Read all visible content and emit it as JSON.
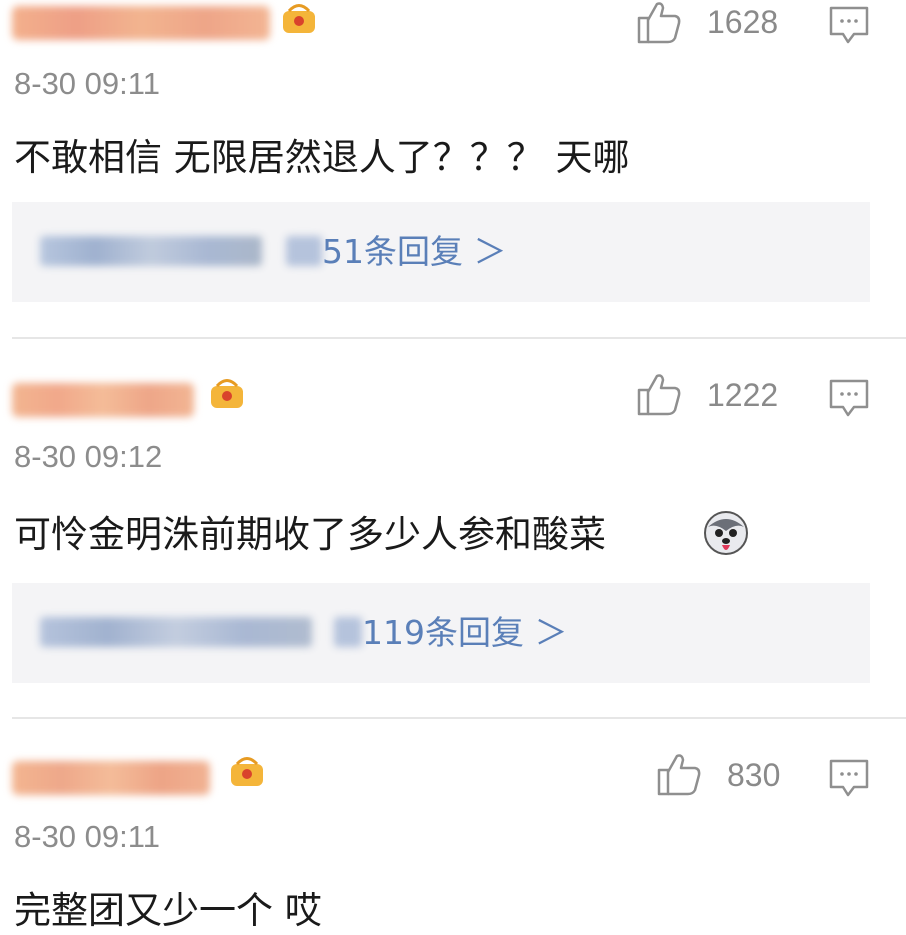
{
  "comments": [
    {
      "timestamp": "8-30 09:11",
      "likes": "1628",
      "text": "不敢相信 无限居然退人了？？？ 天哪",
      "replies_label": "51条回复 ＞"
    },
    {
      "timestamp": "8-30 09:12",
      "likes": "1222",
      "text": "可怜金明洙前期收了多少人参和酸菜",
      "replies_label": "119条回复 ＞"
    },
    {
      "timestamp": "8-30 09:11",
      "likes": "830",
      "text": "完整团又少一个 哎"
    }
  ],
  "icons": {
    "like": "thumbs-up-icon",
    "reply": "comment-bubble-icon",
    "badge": "vip-badge-icon",
    "emoji": "husky-emoji-icon"
  },
  "colors": {
    "reply_link": "#5a7fb8",
    "reply_bg": "#f4f4f6",
    "username_blur": "#f0a070"
  }
}
